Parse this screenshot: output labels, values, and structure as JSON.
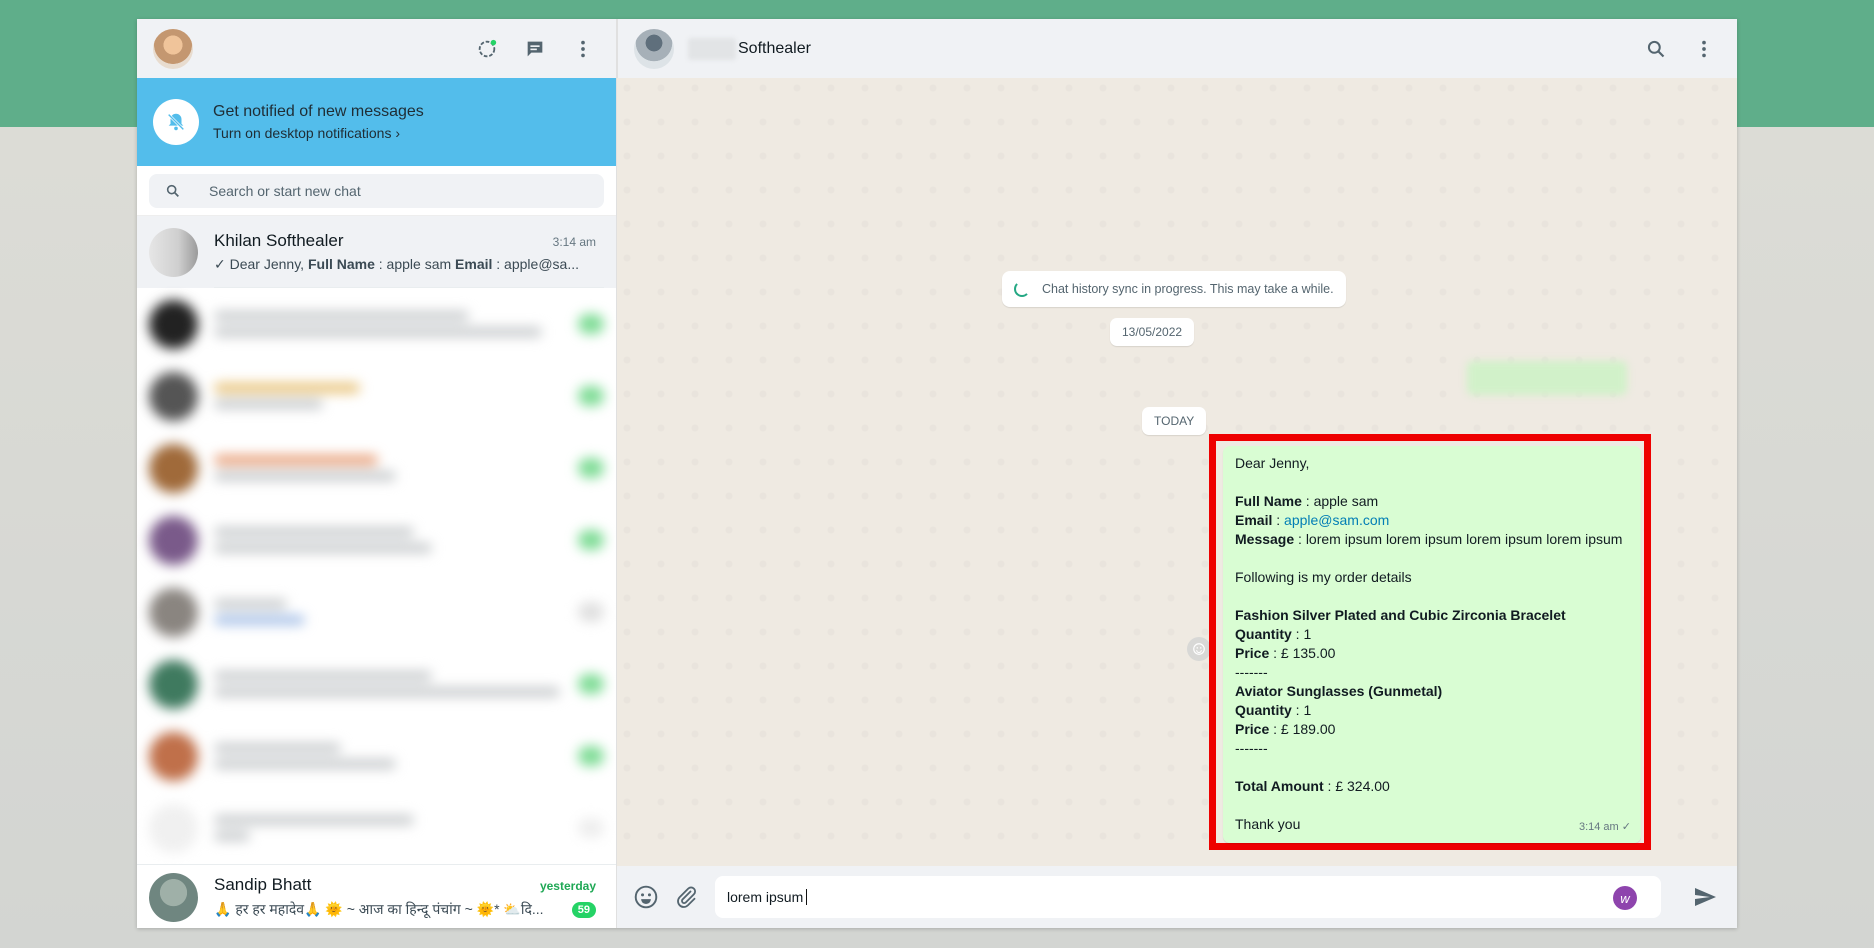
{
  "left": {
    "notification": {
      "title": "Get notified of new messages",
      "subtitle": "Turn on desktop notifications ›"
    },
    "search": {
      "placeholder": "Search or start new chat"
    },
    "active_chat": {
      "name": "Khilan Softhealer",
      "time": "3:14 am",
      "preview_parts": [
        "Dear Jenny,  ",
        "Full Name",
        " : apple sam ",
        "Email",
        " : apple@sa..."
      ]
    },
    "bottom_chat": {
      "name": "Sandip Bhatt",
      "time": "yesterday",
      "preview": "🙏 हर हर महादेव🙏 🌞 ~ आज का हिन्दू पंचांग ~ 🌞* ⛅दि...",
      "unread": "59"
    }
  },
  "chat": {
    "contact_name": "Softhealer",
    "sync_text": "Chat history sync in progress. This may take a while.",
    "date_old": "13/05/2022",
    "date_today": "TODAY",
    "message": {
      "greeting": "Dear Jenny,",
      "full_name_label": "Full Name",
      "full_name_value": " : apple sam",
      "email_label": "Email",
      "email_sep": " : ",
      "email_value": "apple@sam.com",
      "message_label": "Message",
      "message_value": " : lorem ipsum lorem ipsum lorem ipsum lorem ipsum",
      "intro": "Following is my order details",
      "item1_name": "Fashion Silver Plated and Cubic Zirconia Bracelet",
      "qty_label": "Quantity",
      "item1_qty": " : 1",
      "price_label": "Price",
      "item1_price": " : £ 135.00",
      "separator": "-------",
      "item2_name": "Aviator Sunglasses (Gunmetal)",
      "item2_qty": " : 1",
      "item2_price": " : £ 189.00",
      "total_label": "Total Amount",
      "total_value": " : £ 324.00",
      "closing": "Thank you",
      "time": "3:14 am ✓"
    },
    "composer": {
      "text": "lorem ipsum",
      "ext_badge": "w"
    }
  },
  "colors": {
    "header_band": "#5fae8a",
    "notif_bg": "#53bdeb",
    "outgoing_bubble": "#d9fdd3",
    "highlight": "#ee0000",
    "unread_badge": "#25d366"
  }
}
